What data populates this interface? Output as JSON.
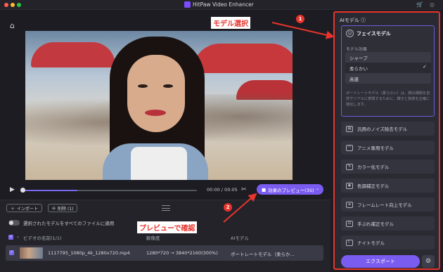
{
  "window": {
    "title": "HitPaw Video Enhancer"
  },
  "player": {
    "time": "00:00 / 00:05",
    "preview_label": "効果のプレビュー(3S)",
    "progress": 0.32
  },
  "toolbar": {
    "import_label": "インポート",
    "delete_label": "削除 (1)"
  },
  "filelist": {
    "apply_all_label": "選択されたモデルをすべてのファイルに適用",
    "columns": {
      "name": "ビデオの名前(1/1)",
      "resolution": "解像度",
      "model": "AIモデル"
    },
    "rows": [
      {
        "name": "1117795_1080p_4k_1280x720.mp4",
        "resolution": "1280*720 → 3840*2160(300%)",
        "model": "ポートレートモデル（柔らか..."
      }
    ]
  },
  "panel": {
    "title": "AIモデル ⓘ",
    "face_model": {
      "label": "フェイスモデル",
      "effect_label": "モデル効果",
      "options": [
        "シャープ",
        "柔らかい",
        "高速"
      ],
      "selected": "柔らかい",
      "description": "ポートレートモデル（柔らかい）は、顔の細部を自然でリアルに表現するために、輝きと質感を正確に強化します。"
    },
    "models": [
      {
        "label": "汎用のノイズ除去モデル",
        "icon": "film-icon"
      },
      {
        "label": "アニメ専用モデル",
        "icon": "anime-icon"
      },
      {
        "label": "カラー化モデル",
        "icon": "brush-icon"
      },
      {
        "label": "色調補正モデル",
        "icon": "palette-icon"
      },
      {
        "label": "フレームレート向上モデル",
        "icon": "frames-icon"
      },
      {
        "label": "手ぶれ補正モデル",
        "icon": "stabilize-icon"
      },
      {
        "label": "ナイトモデル",
        "icon": "moon-icon"
      }
    ],
    "export_label": "エクスポート"
  },
  "annotations": {
    "select_label": "モデル選択",
    "select_num": "1",
    "preview_label": "プレビューで確認",
    "preview_num": "2",
    "color": "#e8342c"
  }
}
